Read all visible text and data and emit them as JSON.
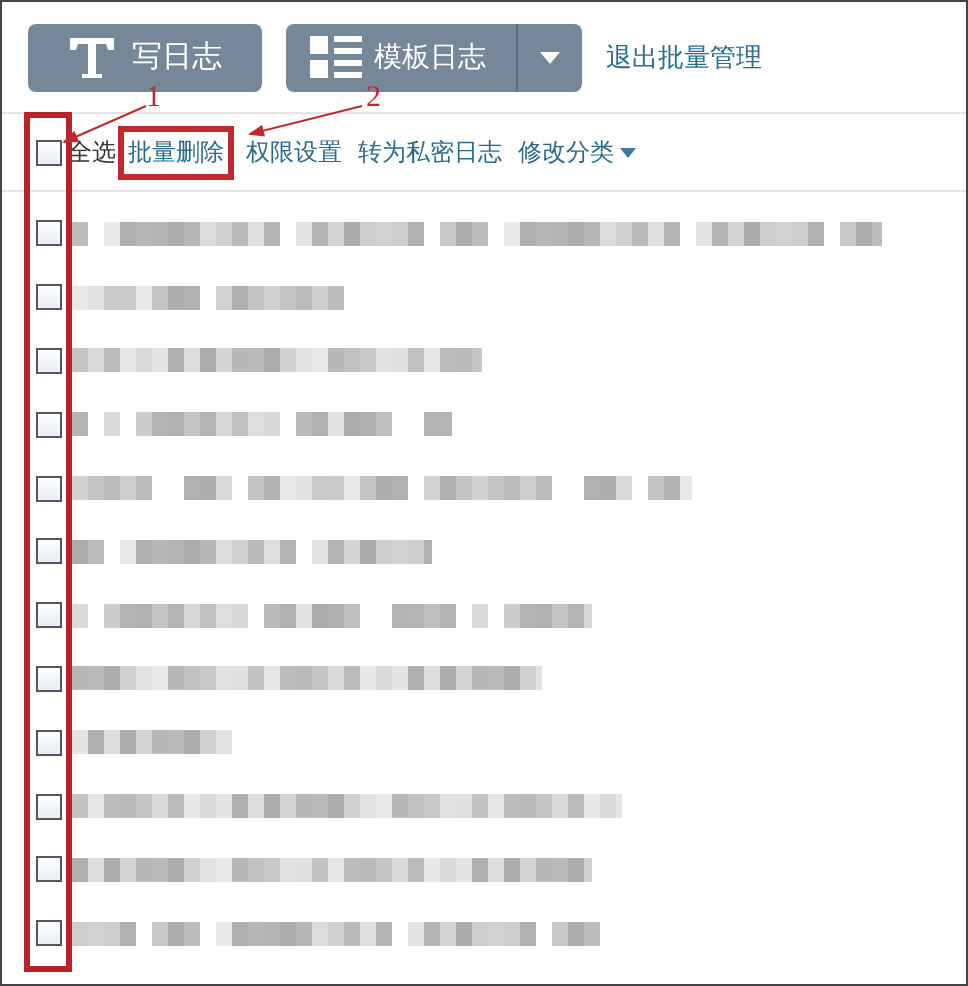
{
  "top_buttons": [
    {
      "kind": "write",
      "label": "写日志"
    },
    {
      "kind": "template",
      "label": "模板日志"
    }
  ],
  "exit_link": "退出批量管理",
  "select_all": {
    "label": "全选",
    "checked": false
  },
  "actions": [
    {
      "label": "批量删除",
      "highlighted": true,
      "dropdown": false
    },
    {
      "label": "权限设置",
      "highlighted": false,
      "dropdown": false
    },
    {
      "label": "转为私密日志",
      "highlighted": false,
      "dropdown": false
    },
    {
      "label": "修改分类",
      "highlighted": false,
      "dropdown": true
    }
  ],
  "rows": [
    {
      "checked": false
    },
    {
      "checked": false
    },
    {
      "checked": false
    },
    {
      "checked": false
    },
    {
      "checked": false
    },
    {
      "checked": false
    },
    {
      "checked": false
    },
    {
      "checked": false
    },
    {
      "checked": false
    },
    {
      "checked": false
    },
    {
      "checked": false
    },
    {
      "checked": false
    }
  ],
  "annotations": [
    {
      "label": "1"
    },
    {
      "label": "2"
    }
  ]
}
